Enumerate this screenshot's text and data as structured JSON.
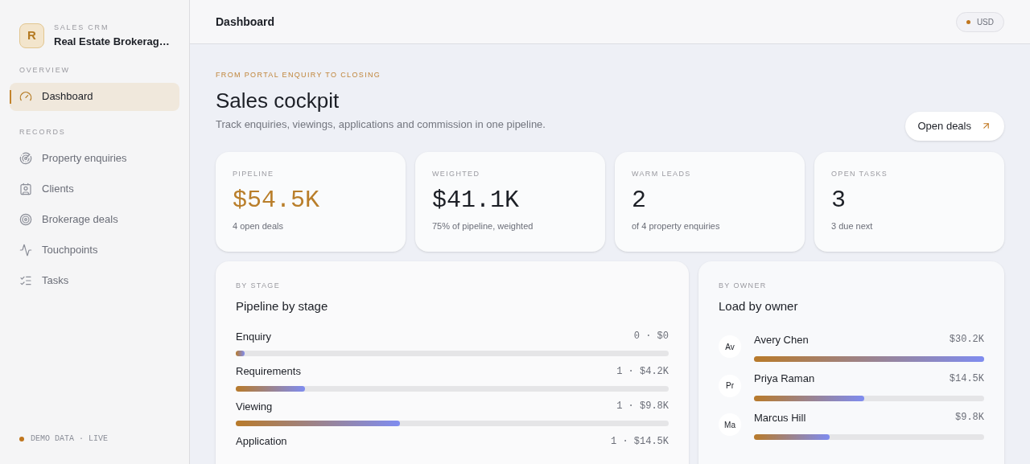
{
  "brand": {
    "initial": "R",
    "eyebrow": "SALES CRM",
    "name": "Real Estate Brokerag…"
  },
  "sidebar": {
    "sections": [
      {
        "title": "OVERVIEW",
        "items": [
          {
            "label": "Dashboard",
            "selected": true
          }
        ]
      },
      {
        "title": "RECORDS",
        "items": [
          {
            "label": "Property enquiries",
            "selected": false
          },
          {
            "label": "Clients",
            "selected": false
          },
          {
            "label": "Brokerage deals",
            "selected": false
          },
          {
            "label": "Touchpoints",
            "selected": false
          },
          {
            "label": "Tasks",
            "selected": false
          }
        ]
      }
    ],
    "footer": "DEMO DATA · LIVE"
  },
  "header": {
    "title": "Dashboard",
    "currency": "USD"
  },
  "hero": {
    "eyebrow": "FROM PORTAL ENQUIRY TO CLOSING",
    "title": "Sales cockpit",
    "subtitle": "Track enquiries, viewings, applications and commission in one pipeline.",
    "button": "Open deals"
  },
  "stats": [
    {
      "label": "PIPELINE",
      "value": "$54.5K",
      "note": "4 open deals",
      "accent": true
    },
    {
      "label": "WEIGHTED",
      "value": "$41.1K",
      "note": "75% of pipeline, weighted",
      "accent": false
    },
    {
      "label": "WARM LEADS",
      "value": "2",
      "note": "of 4 property enquiries",
      "accent": false
    },
    {
      "label": "OPEN TASKS",
      "value": "3",
      "note": "3 due next",
      "accent": false
    }
  ],
  "stages": {
    "eyebrow": "BY STAGE",
    "title": "Pipeline by stage",
    "rows": [
      {
        "name": "Enquiry",
        "reading": "0 · $0",
        "level": 0.02
      },
      {
        "name": "Requirements",
        "reading": "1 · $4.2K",
        "level": 0.16
      },
      {
        "name": "Viewing",
        "reading": "1 · $9.8K",
        "level": 0.38
      },
      {
        "name": "Application",
        "reading": "1 · $14.5K"
      }
    ]
  },
  "owners": {
    "eyebrow": "BY OWNER",
    "title": "Load by owner",
    "rows": [
      {
        "initials": "Av",
        "name": "Avery Chen",
        "reading": "$30.2K",
        "level": 1
      },
      {
        "initials": "Pr",
        "name": "Priya Raman",
        "reading": "$14.5K",
        "level": 0.48
      },
      {
        "initials": "Ma",
        "name": "Marcus Hill",
        "reading": "$9.8K",
        "level": 0.33
      }
    ]
  }
}
